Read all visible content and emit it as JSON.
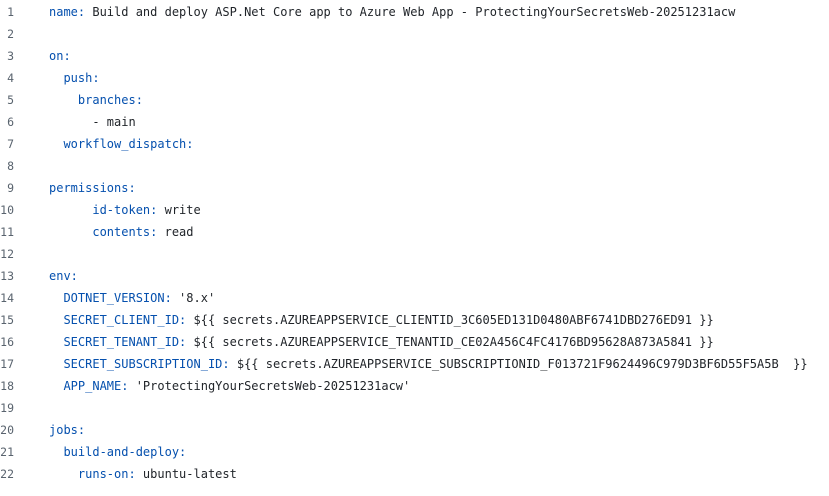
{
  "lines": [
    {
      "num": "1",
      "key": "name:",
      "value": " Build and deploy ASP.Net Core app to Azure Web App - ProtectingYourSecretsWeb-20251231acw"
    },
    {
      "num": "2",
      "key": "",
      "value": ""
    },
    {
      "num": "3",
      "key": "on:",
      "value": ""
    },
    {
      "num": "4",
      "key": "  push:",
      "value": ""
    },
    {
      "num": "5",
      "key": "    branches:",
      "value": ""
    },
    {
      "num": "6",
      "key": "",
      "value": "      - main"
    },
    {
      "num": "7",
      "key": "  workflow_dispatch:",
      "value": ""
    },
    {
      "num": "8",
      "key": "",
      "value": ""
    },
    {
      "num": "9",
      "key": "permissions:",
      "value": ""
    },
    {
      "num": "10",
      "key": "      id-token:",
      "value": " write"
    },
    {
      "num": "11",
      "key": "      contents:",
      "value": " read"
    },
    {
      "num": "12",
      "key": "",
      "value": ""
    },
    {
      "num": "13",
      "key": "env:",
      "value": ""
    },
    {
      "num": "14",
      "key": "  DOTNET_VERSION:",
      "value": " '8.x'"
    },
    {
      "num": "15",
      "key": "  SECRET_CLIENT_ID:",
      "value": " ${{ secrets.AZUREAPPSERVICE_CLIENTID_3C605ED131D0480ABF6741DBD276ED91 }}"
    },
    {
      "num": "16",
      "key": "  SECRET_TENANT_ID:",
      "value": " ${{ secrets.AZUREAPPSERVICE_TENANTID_CE02A456C4FC4176BD95628A873A5841 }}"
    },
    {
      "num": "17",
      "key": "  SECRET_SUBSCRIPTION_ID:",
      "value": " ${{ secrets.AZUREAPPSERVICE_SUBSCRIPTIONID_F013721F9624496C979D3BF6D55F5A5B  }}"
    },
    {
      "num": "18",
      "key": "  APP_NAME:",
      "value": " 'ProtectingYourSecretsWeb-20251231acw'"
    },
    {
      "num": "19",
      "key": "",
      "value": ""
    },
    {
      "num": "20",
      "key": "jobs:",
      "value": ""
    },
    {
      "num": "21",
      "key": "  build-and-deploy:",
      "value": ""
    },
    {
      "num": "22",
      "key": "    runs-on:",
      "value": " ubuntu-latest"
    }
  ],
  "colors": {
    "key": "#0550ae",
    "value": "#1f2328",
    "line_number": "#59636e",
    "background": "#ffffff"
  }
}
